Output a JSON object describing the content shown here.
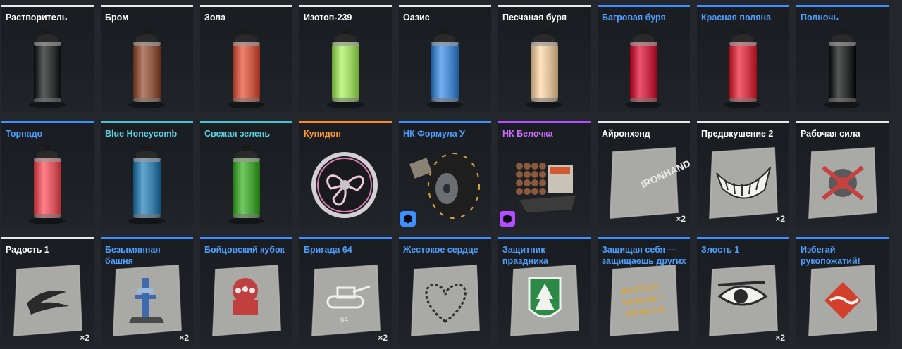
{
  "rarity_colors": {
    "white": "#e8e8e8",
    "blue": "#3f8fff",
    "cyan": "#46c1d6",
    "orange": "#ff8a1c",
    "purple": "#b44cff"
  },
  "row1": [
    {
      "title": "Растворитель",
      "rarity": "white",
      "icon": "spray-can-icon",
      "color": "#333536"
    },
    {
      "title": "Бром",
      "rarity": "white",
      "icon": "spray-can-icon",
      "color": "#8f5a45"
    },
    {
      "title": "Зола",
      "rarity": "white",
      "icon": "spray-can-icon",
      "color": "#c85a48"
    },
    {
      "title": "Изотоп-239",
      "rarity": "white",
      "icon": "spray-can-icon",
      "color": "#9ad062"
    },
    {
      "title": "Оазис",
      "rarity": "white",
      "icon": "spray-can-icon",
      "color": "#4b86c8"
    },
    {
      "title": "Песчаная буря",
      "rarity": "white",
      "icon": "spray-can-icon",
      "color": "#d9bd98"
    },
    {
      "title": "Багровая буря",
      "rarity": "blue",
      "icon": "spray-can-icon",
      "color": "#c22a45"
    },
    {
      "title": "Красная поляна",
      "rarity": "blue",
      "icon": "spray-can-icon",
      "color": "#cc3a48"
    },
    {
      "title": "Полночь",
      "rarity": "blue",
      "icon": "spray-can-icon",
      "color": "#2e2f2f"
    }
  ],
  "row2": [
    {
      "title": "Торнадо",
      "rarity": "blue",
      "icon": "spray-can-icon",
      "color": "#d85860"
    },
    {
      "title": "Blue Honeycomb",
      "rarity": "cyan",
      "icon": "spray-can-icon",
      "color": "#3d7ea8"
    },
    {
      "title": "Свежая зелень",
      "rarity": "cyan",
      "icon": "spray-can-icon",
      "color": "#4aa03a"
    },
    {
      "title": "Купидон",
      "rarity": "orange",
      "icon": "wheel-rim-icon",
      "color": "#d87ab0"
    },
    {
      "title": "НК Формула У",
      "rarity": "blue",
      "icon": "wheel-icon",
      "badge": "blue"
    },
    {
      "title": "НК Белочка",
      "rarity": "purple",
      "icon": "rocket-launcher-icon",
      "badge": "purple"
    },
    {
      "title": "Айронхэнд",
      "rarity": "white",
      "icon": "decal-ironhand-icon",
      "count": "×2"
    },
    {
      "title": "Предвкушение 2",
      "rarity": "white",
      "icon": "decal-grin-icon",
      "count": "×2"
    },
    {
      "title": "Рабочая сила",
      "rarity": "white",
      "icon": "decal-wrench-icon"
    }
  ],
  "row3": [
    {
      "title": "Радость 1",
      "rarity": "white",
      "icon": "decal-swoosh-icon",
      "count": "×2"
    },
    {
      "title": "Безымянная башня",
      "rarity": "blue",
      "icon": "decal-tower-icon",
      "count": "×2"
    },
    {
      "title": "Бойцовский кубок",
      "rarity": "blue",
      "icon": "decal-fist-icon"
    },
    {
      "title": "Бригада 64",
      "rarity": "blue",
      "icon": "decal-tank-icon",
      "count": "×2"
    },
    {
      "title": "Жестокое сердце",
      "rarity": "blue",
      "icon": "decal-heart-icon"
    },
    {
      "title": "Защитник праздника",
      "rarity": "blue",
      "icon": "decal-tree-icon"
    },
    {
      "title": "Защищая себя — защищаешь других",
      "rarity": "blue",
      "icon": "decal-text-icon"
    },
    {
      "title": "Злость 1",
      "rarity": "blue",
      "icon": "decal-eye-icon",
      "count": "×2"
    },
    {
      "title": "Избегай рукопожатий!",
      "rarity": "blue",
      "icon": "decal-handshake-icon"
    }
  ]
}
